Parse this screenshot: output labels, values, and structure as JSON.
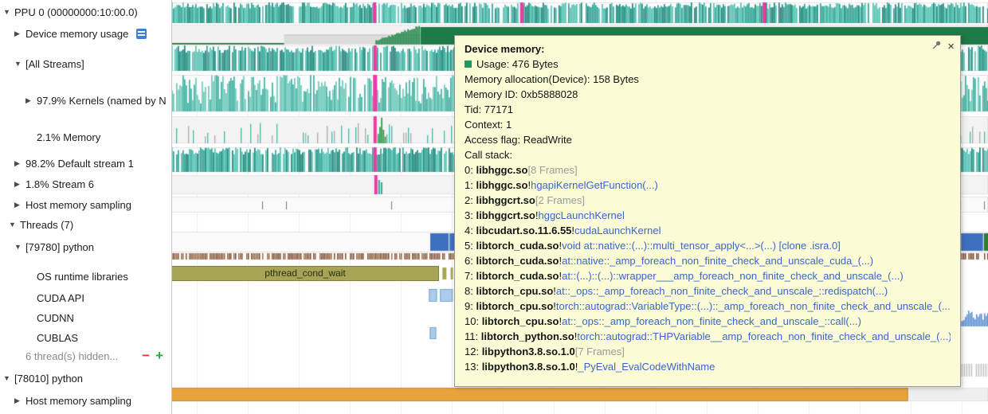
{
  "colors": {
    "teal": "#2fa897",
    "teal_dark": "#1d8a7b",
    "teal_light": "#55c5b5",
    "pink_marker": "#ee39a4",
    "memory_green": "#1e7a46",
    "olive": "#a8a455",
    "orange": "#e8a33d",
    "thread_green": "#44a04e",
    "thread_blue": "#3f6fbf",
    "cuda_blue": "#abcdeb",
    "link_blue": "#3a66c8",
    "frames_gray": "#9a9a9a",
    "tooltip_bg": "#fbfbd6"
  },
  "sidebar": {
    "items": [
      {
        "label": "PPU 0 (00000000:10:00.0)",
        "indent": 0,
        "arrow": "down"
      },
      {
        "label": "Device memory usage",
        "indent": 1,
        "arrow": "right",
        "icon": "chart-view"
      },
      {
        "label": "[All Streams]",
        "indent": 1,
        "arrow": "down"
      },
      {
        "label": "97.9% Kernels (named by N",
        "indent": 2,
        "arrow": "right"
      },
      {
        "label": "2.1% Memory",
        "indent": 2,
        "arrow": null
      },
      {
        "label": "98.2% Default stream 1",
        "indent": 1,
        "arrow": "right"
      },
      {
        "label": "1.8% Stream 6",
        "indent": 1,
        "arrow": "right"
      },
      {
        "label": "Host memory sampling",
        "indent": 1,
        "arrow": "right"
      },
      {
        "label": "Threads (7)",
        "indent": 0.5,
        "arrow": "down"
      },
      {
        "label": "[79780] python",
        "indent": 1,
        "arrow": "down"
      },
      {
        "label": "OS runtime libraries",
        "indent": 2,
        "arrow": null
      },
      {
        "label": "CUDA API",
        "indent": 2,
        "arrow": null
      },
      {
        "label": "CUDNN",
        "indent": 2,
        "arrow": null
      },
      {
        "label": "CUBLAS",
        "indent": 2,
        "arrow": null
      },
      {
        "label": "6 thread(s) hidden...",
        "indent": 1,
        "arrow": null,
        "muted": true,
        "controls": true
      },
      {
        "label": "[78010] python",
        "indent": 0,
        "arrow": "down"
      },
      {
        "label": "Host memory sampling",
        "indent": 1,
        "arrow": "right"
      }
    ]
  },
  "timeline": {
    "os_runtime_span_label": "pthread_cond_wait"
  },
  "tooltip": {
    "title": "Device memory:",
    "usage": "Usage: 476 Bytes",
    "lines": [
      "Memory allocation(Device): 158 Bytes",
      "Memory ID: 0xb5888028",
      "Tid: 77171",
      "Context: 1",
      "Access flag: ReadWrite"
    ],
    "call_stack_label": "Call stack:",
    "call_stack": [
      {
        "num": "0",
        "module": "libhggc.so",
        "frames": "[8 Frames]"
      },
      {
        "num": "1",
        "module": "libhggc.so",
        "func": "hgapiKernelGetFunction(...)"
      },
      {
        "num": "2",
        "module": "libhggcrt.so",
        "frames": "[2 Frames]"
      },
      {
        "num": "3",
        "module": "libhggcrt.so",
        "func": "hggcLaunchKernel"
      },
      {
        "num": "4",
        "module": "libcudart.so.11.6.55",
        "func": "cudaLaunchKernel"
      },
      {
        "num": "5",
        "module": "libtorch_cuda.so",
        "func": "void at::native::(...)::multi_tensor_apply<...>(...) [clone .isra.0]"
      },
      {
        "num": "6",
        "module": "libtorch_cuda.so",
        "func": "at::native::_amp_foreach_non_finite_check_and_unscale_cuda_(...)"
      },
      {
        "num": "7",
        "module": "libtorch_cuda.so",
        "func": "at::(...)::(...)::wrapper___amp_foreach_non_finite_check_and_unscale_(...)"
      },
      {
        "num": "8",
        "module": "libtorch_cpu.so",
        "func": "at::_ops::_amp_foreach_non_finite_check_and_unscale_::redispatch(...)"
      },
      {
        "num": "9",
        "module": "libtorch_cpu.so",
        "func": "torch::autograd::VariableType::(...)::_amp_foreach_non_finite_check_and_unscale_(...)"
      },
      {
        "num": "10",
        "module": "libtorch_cpu.so",
        "func": "at::_ops::_amp_foreach_non_finite_check_and_unscale_::call(...)"
      },
      {
        "num": "11",
        "module": "libtorch_python.so",
        "func": "torch::autograd::THPVariable__amp_foreach_non_finite_check_and_unscale_(...)"
      },
      {
        "num": "12",
        "module": "libpython3.8.so.1.0",
        "frames": "[7 Frames]"
      },
      {
        "num": "13",
        "module": "libpython3.8.so.1.0",
        "func": "_PyEval_EvalCodeWithName"
      }
    ]
  }
}
